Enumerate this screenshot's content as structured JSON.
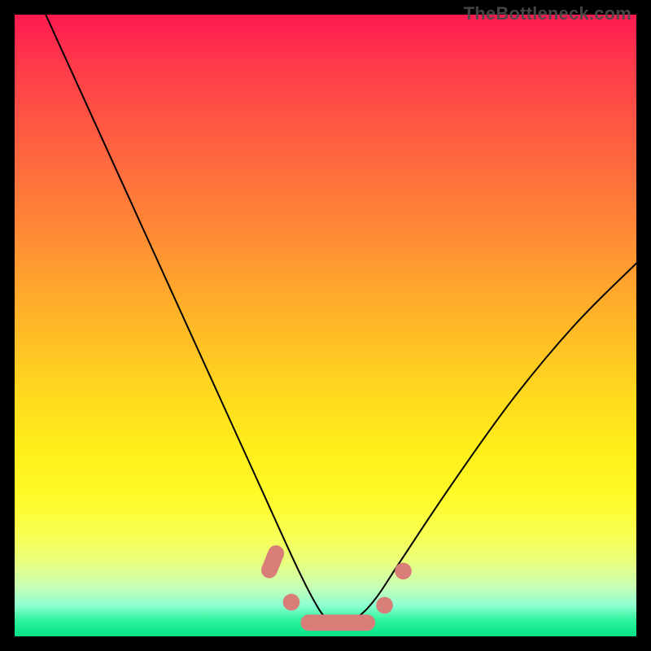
{
  "watermark": "TheBottleneck.com",
  "chart_data": {
    "type": "line",
    "title": "",
    "xlabel": "",
    "ylabel": "",
    "xlim": [
      0,
      100
    ],
    "ylim": [
      0,
      100
    ],
    "grid": false,
    "series": [
      {
        "name": "curve",
        "x": [
          5,
          10,
          15,
          20,
          25,
          30,
          35,
          40,
          45,
          48,
          50,
          52,
          55,
          58,
          62,
          70,
          80,
          90,
          100
        ],
        "y": [
          100,
          89,
          78,
          67,
          56,
          45,
          34,
          23,
          12,
          6,
          3,
          2,
          3,
          6,
          12,
          24,
          38,
          50,
          60
        ]
      }
    ],
    "markers": [
      {
        "type": "capsule",
        "cx": 41.5,
        "cy": 12.0,
        "len": 5.5,
        "angle": -68
      },
      {
        "type": "dot",
        "cx": 44.5,
        "cy": 5.5
      },
      {
        "type": "capsule",
        "cx": 52.0,
        "cy": 2.2,
        "len": 12.0,
        "angle": 0
      },
      {
        "type": "dot",
        "cx": 59.5,
        "cy": 5.0
      },
      {
        "type": "dot",
        "cx": 62.5,
        "cy": 10.5
      }
    ],
    "colors": {
      "curve": "#000000",
      "markers": "#d97d78"
    }
  }
}
